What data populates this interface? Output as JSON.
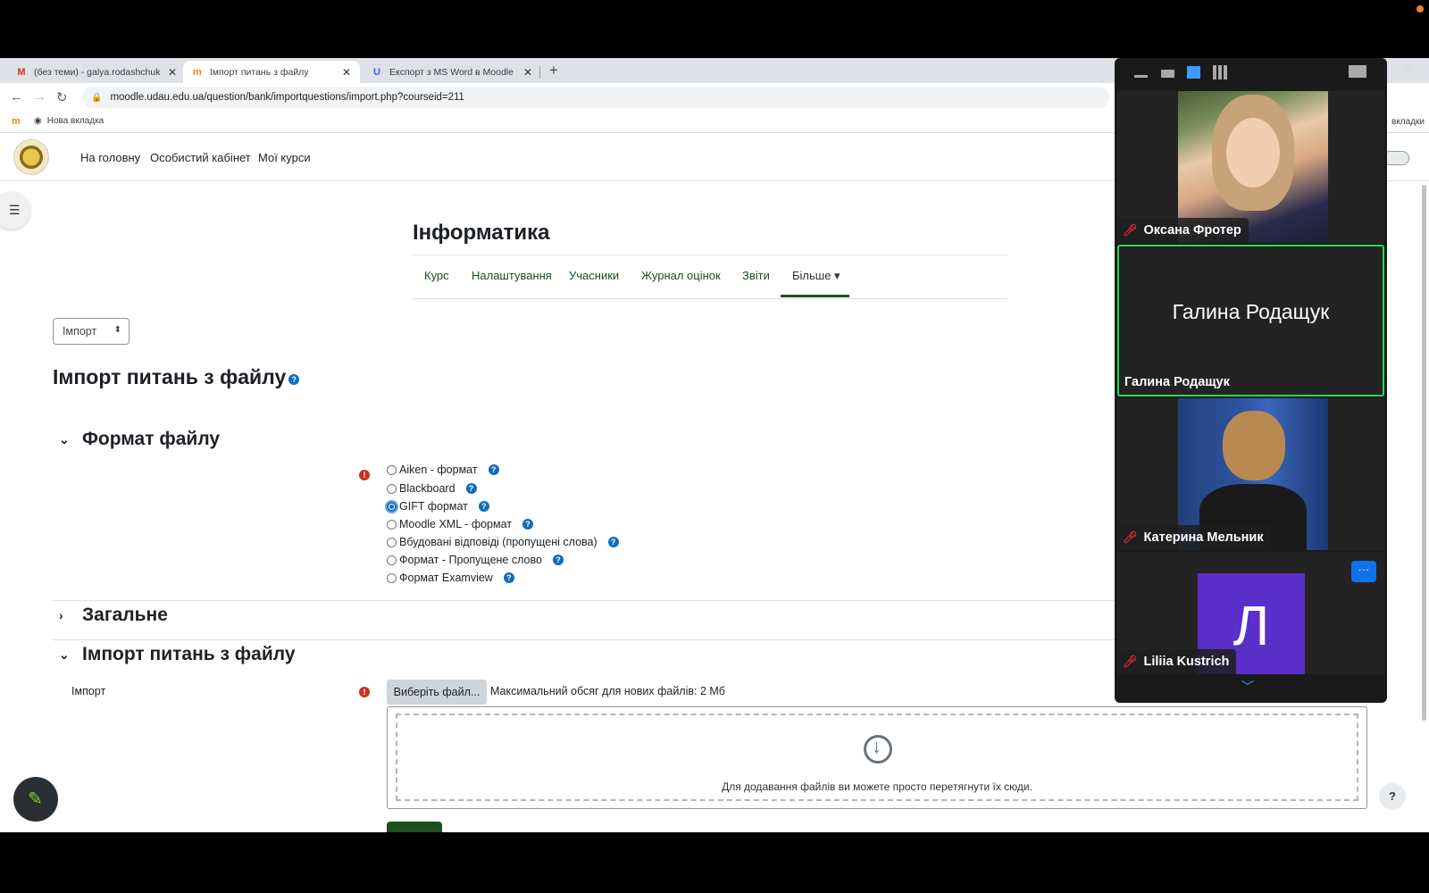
{
  "browser": {
    "tabs": [
      {
        "title": "(без теми) - galya.rodashchuk@",
        "icon": "gmail-icon"
      },
      {
        "title": "Імпорт питань з файлу",
        "icon": "moodle-icon"
      },
      {
        "title": "Експорт з MS Word в Moodle G",
        "icon": "u-icon"
      }
    ],
    "url": "moodle.udau.edu.ua/question/bank/importquestions/import.php?courseid=211",
    "bookmark": "Нова вкладка",
    "right_ext_text": "вкладки"
  },
  "moodle": {
    "nav": [
      "На головну",
      "Особистий кабінет",
      "Мої курси"
    ],
    "course_title": "Інформатика",
    "secondary_nav": [
      "Курс",
      "Налаштування",
      "Учасники",
      "Журнал оцінок",
      "Звіти",
      "Більше ▾"
    ],
    "select_value": "Імпорт",
    "page_heading": "Імпорт питань з файлу",
    "sections": {
      "format": "Формат файлу",
      "general": "Загальне",
      "import": "Імпорт питань з файлу"
    },
    "formats": [
      {
        "label": "Aiken - формат",
        "checked": false
      },
      {
        "label": "Blackboard",
        "checked": false
      },
      {
        "label": "GIFT формат",
        "checked": true
      },
      {
        "label": "Moodle XML - формат",
        "checked": false
      },
      {
        "label": "Вбудовані відповіді (пропущені слова)",
        "checked": false
      },
      {
        "label": "Формат - Пропущене слово",
        "checked": false
      },
      {
        "label": "Формат Examview",
        "checked": false
      }
    ],
    "import_label": "Імпорт",
    "file_button": "Виберіть файл...",
    "max_size": "Максимальний обсяг для нових файлів: 2 Мб",
    "dropzone_text": "Для додавання файлів ви можете просто перетягнути їх сюди.",
    "help_fab": "?"
  },
  "zoom": {
    "participants": [
      {
        "name": "Оксана Фротер",
        "muted": true,
        "video": true
      },
      {
        "name": "Галина Родащук",
        "muted": false,
        "video": false,
        "speaking": true
      },
      {
        "name": "Катерина Мельник",
        "muted": true,
        "video": true
      },
      {
        "name": "Liliia Kustrich",
        "muted": true,
        "video": false,
        "avatar_letter": "Л"
      }
    ],
    "more_label": "···",
    "accent_color": "#23d959"
  }
}
